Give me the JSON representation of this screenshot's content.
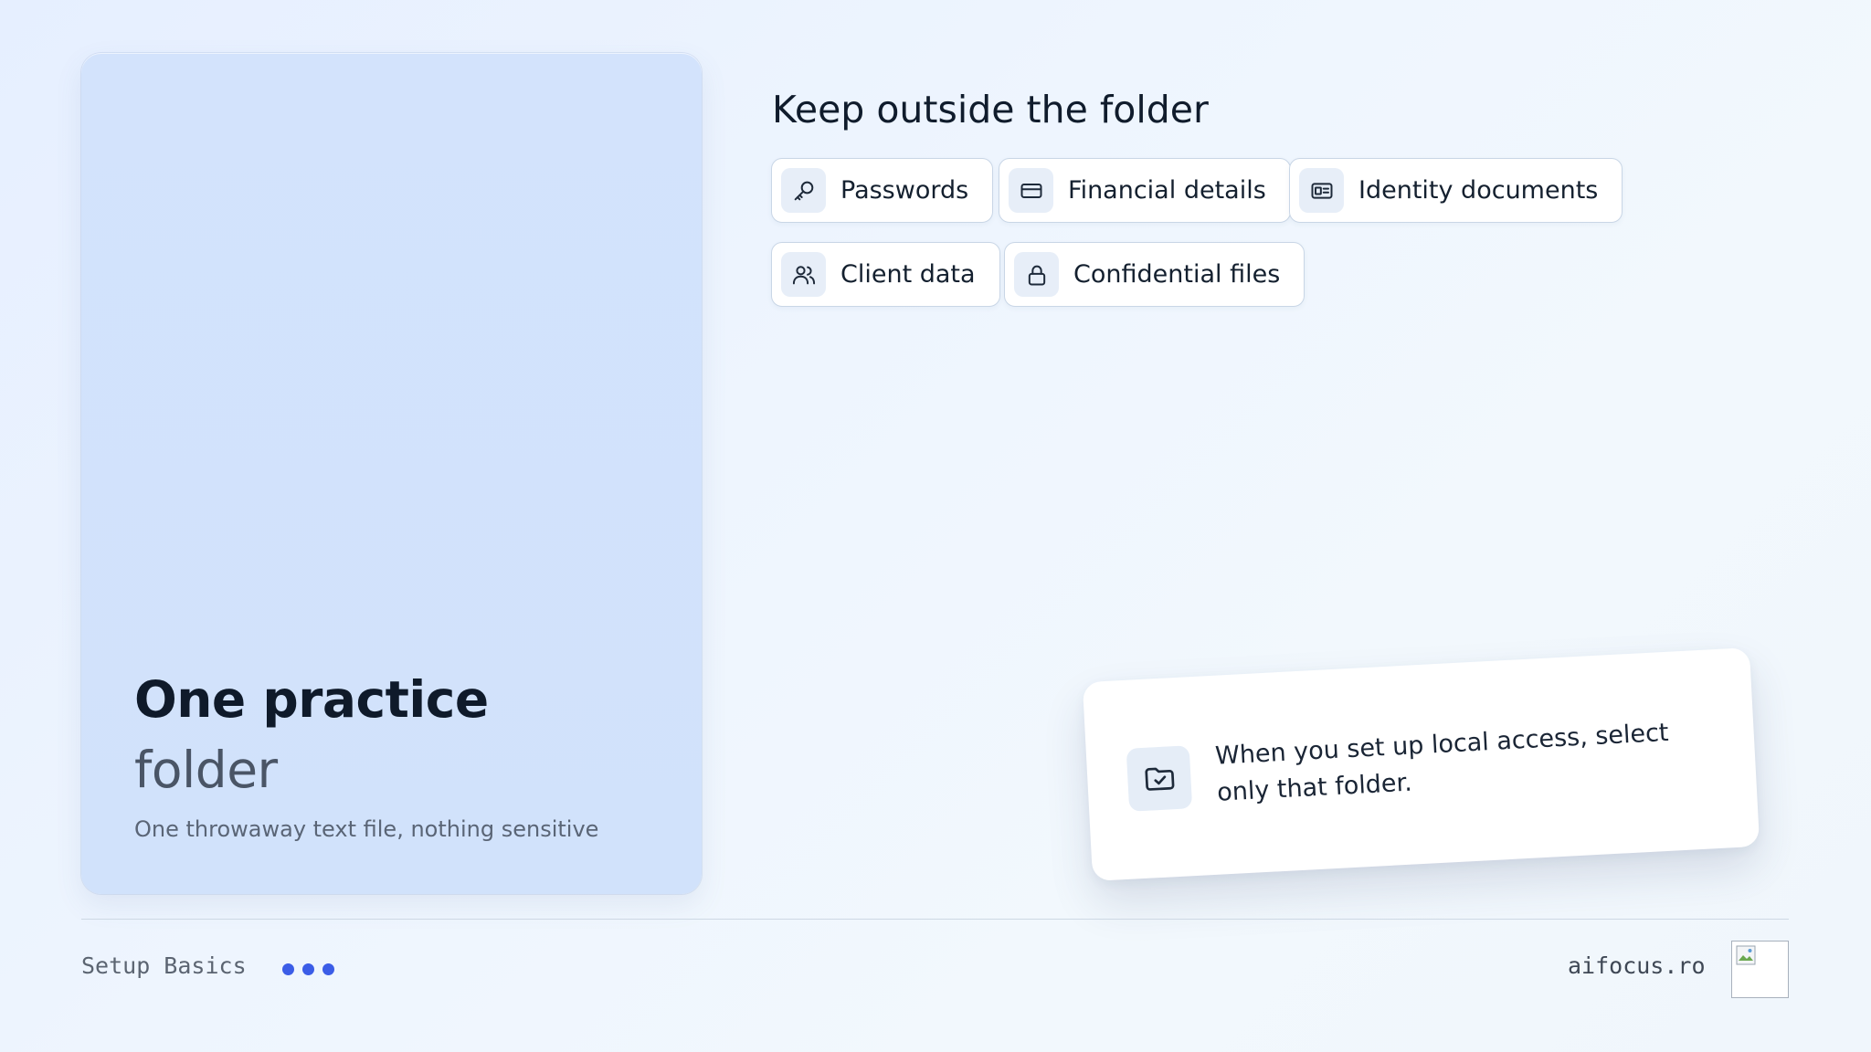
{
  "left_card": {
    "title_line1": "One practice",
    "title_line2": "folder",
    "subtitle": "One throwaway text file, nothing sensitive"
  },
  "section": {
    "heading": "Keep outside the folder",
    "items": [
      {
        "label": "Passwords",
        "icon": "key-icon"
      },
      {
        "label": "Financial details",
        "icon": "credit-card-icon"
      },
      {
        "label": "Identity documents",
        "icon": "id-card-icon"
      },
      {
        "label": "Client data",
        "icon": "users-icon"
      },
      {
        "label": "Confidential files",
        "icon": "lock-icon"
      }
    ]
  },
  "callout": {
    "icon": "folder-check-icon",
    "text": "When you set up local access, select only that folder."
  },
  "footer": {
    "left_label": "Setup Basics",
    "right_label": "aifocus.ro",
    "logo_icon": "broken-image-icon"
  },
  "colors": {
    "accent": "#3b5de7",
    "card_bg": "#d3e3fc",
    "chip_border": "#c9d6e6",
    "icon_bg": "#e7eef8",
    "text_dark": "#0f1a2a"
  }
}
